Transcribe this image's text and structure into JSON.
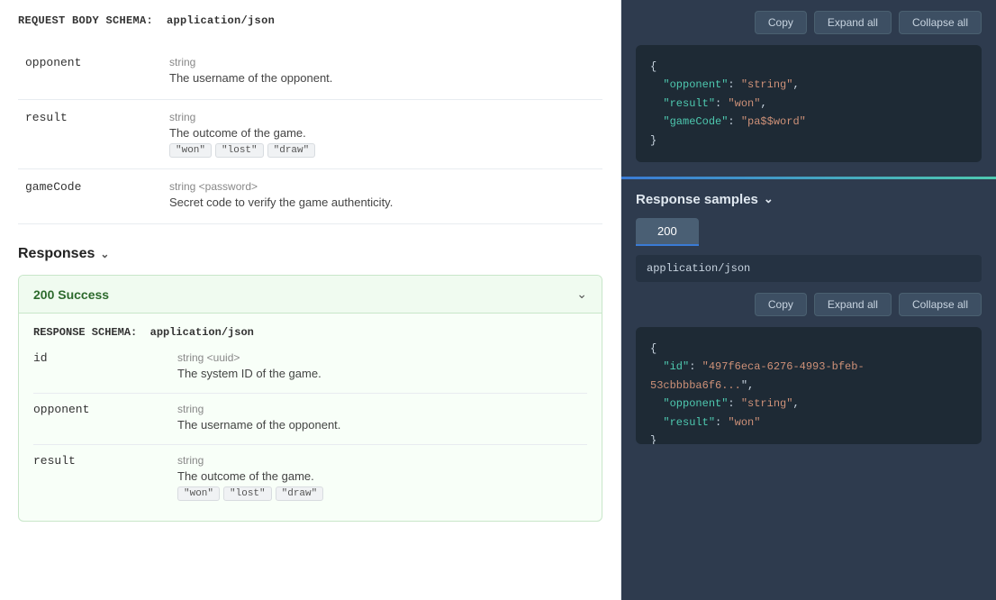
{
  "leftPanel": {
    "requestBodyLabel": "REQUEST BODY SCHEMA:",
    "requestBodyType": "application/json",
    "fields": [
      {
        "name": "opponent",
        "type": "string",
        "description": "The username of the opponent.",
        "enums": []
      },
      {
        "name": "result",
        "type": "string",
        "description": "The outcome of the game.",
        "enums": [
          "\"won\"",
          "\"lost\"",
          "\"draw\""
        ]
      },
      {
        "name": "gameCode",
        "type": "string <password>",
        "description": "Secret code to verify the game authenticity.",
        "enums": []
      }
    ],
    "responsesHeader": "Responses",
    "response200": {
      "title": "200 Success",
      "schemaLabel": "RESPONSE SCHEMA:",
      "schemaType": "application/json",
      "fields": [
        {
          "name": "id",
          "type": "string <uuid>",
          "description": "The system ID of the game.",
          "enums": []
        },
        {
          "name": "opponent",
          "type": "string",
          "description": "The username of the opponent.",
          "enums": []
        },
        {
          "name": "result",
          "type": "string",
          "description": "The outcome of the game.",
          "enums": [
            "\"won\"",
            "\"lost\"",
            "\"draw\""
          ]
        }
      ]
    }
  },
  "rightPanel": {
    "toolbar": {
      "copyLabel": "Copy",
      "expandAllLabel": "Expand all",
      "collapseAllLabel": "Collapse all"
    },
    "requestCode": {
      "lines": [
        "{",
        "  \"opponent\": \"string\",",
        "  \"result\": \"won\",",
        "  \"gameCode\": \"pa$$word\"",
        "}"
      ]
    },
    "responseSamples": {
      "header": "Response samples",
      "tabs": [
        "200"
      ],
      "mediaType": "application/json",
      "toolbar": {
        "copyLabel": "Copy",
        "expandAllLabel": "Expand all",
        "collapseAllLabel": "Collapse all"
      },
      "code": {
        "lines": [
          "{",
          "  \"id\": \"497f6eca-6276-4993-bfeb-53cbbbba6f6...\",",
          "  \"opponent\": \"string\",",
          "  \"result\": \"won\"",
          "}"
        ]
      }
    }
  }
}
